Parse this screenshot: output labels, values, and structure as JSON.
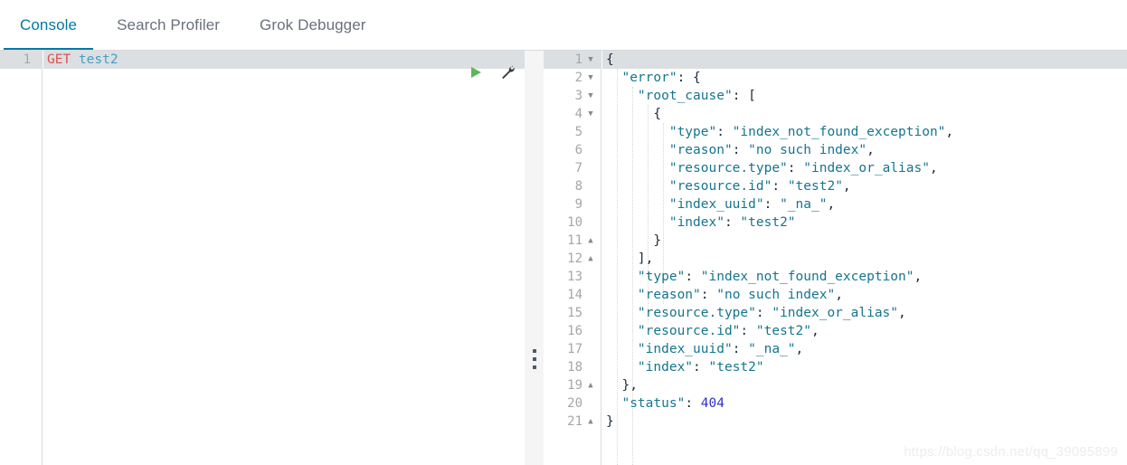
{
  "tabs": [
    {
      "label": "Console",
      "active": true
    },
    {
      "label": "Search Profiler",
      "active": false
    },
    {
      "label": "Grok Debugger",
      "active": false
    }
  ],
  "accent_color": "#0079a5",
  "request_editor": {
    "name": "console-request-editor",
    "active_line": 1,
    "gutter_lines": [
      "1"
    ],
    "lines": [
      {
        "number": "1",
        "method": "GET",
        "path": "test2"
      }
    ],
    "actions": [
      {
        "name": "send-request-play-icon",
        "label": "▶",
        "color": "#5cb85c"
      },
      {
        "name": "wrench-icon",
        "label": "wrench",
        "color": "#343741"
      }
    ]
  },
  "response_editor": {
    "name": "console-response-editor",
    "active_line": 1,
    "lines": [
      {
        "number": "1",
        "fold": "down",
        "text": "{"
      },
      {
        "number": "2",
        "fold": "down",
        "text": "  \"error\": {"
      },
      {
        "number": "3",
        "fold": "down",
        "text": "    \"root_cause\": ["
      },
      {
        "number": "4",
        "fold": "down",
        "text": "      {"
      },
      {
        "number": "5",
        "fold": "",
        "text": "        \"type\": \"index_not_found_exception\","
      },
      {
        "number": "6",
        "fold": "",
        "text": "        \"reason\": \"no such index\","
      },
      {
        "number": "7",
        "fold": "",
        "text": "        \"resource.type\": \"index_or_alias\","
      },
      {
        "number": "8",
        "fold": "",
        "text": "        \"resource.id\": \"test2\","
      },
      {
        "number": "9",
        "fold": "",
        "text": "        \"index_uuid\": \"_na_\","
      },
      {
        "number": "10",
        "fold": "",
        "text": "        \"index\": \"test2\""
      },
      {
        "number": "11",
        "fold": "up",
        "text": "      }"
      },
      {
        "number": "12",
        "fold": "up",
        "text": "    ],"
      },
      {
        "number": "13",
        "fold": "",
        "text": "    \"type\": \"index_not_found_exception\","
      },
      {
        "number": "14",
        "fold": "",
        "text": "    \"reason\": \"no such index\","
      },
      {
        "number": "15",
        "fold": "",
        "text": "    \"resource.type\": \"index_or_alias\","
      },
      {
        "number": "16",
        "fold": "",
        "text": "    \"resource.id\": \"test2\","
      },
      {
        "number": "17",
        "fold": "",
        "text": "    \"index_uuid\": \"_na_\","
      },
      {
        "number": "18",
        "fold": "",
        "text": "    \"index\": \"test2\""
      },
      {
        "number": "19",
        "fold": "up",
        "text": "  },"
      },
      {
        "number": "20",
        "fold": "",
        "text": "  \"status\": 404"
      },
      {
        "number": "21",
        "fold": "up",
        "text": "}"
      }
    ]
  },
  "splitter": {
    "name": "pane-drag-handle",
    "glyph": "⋮"
  },
  "watermark": "https://blog.csdn.net/qq_39095899"
}
